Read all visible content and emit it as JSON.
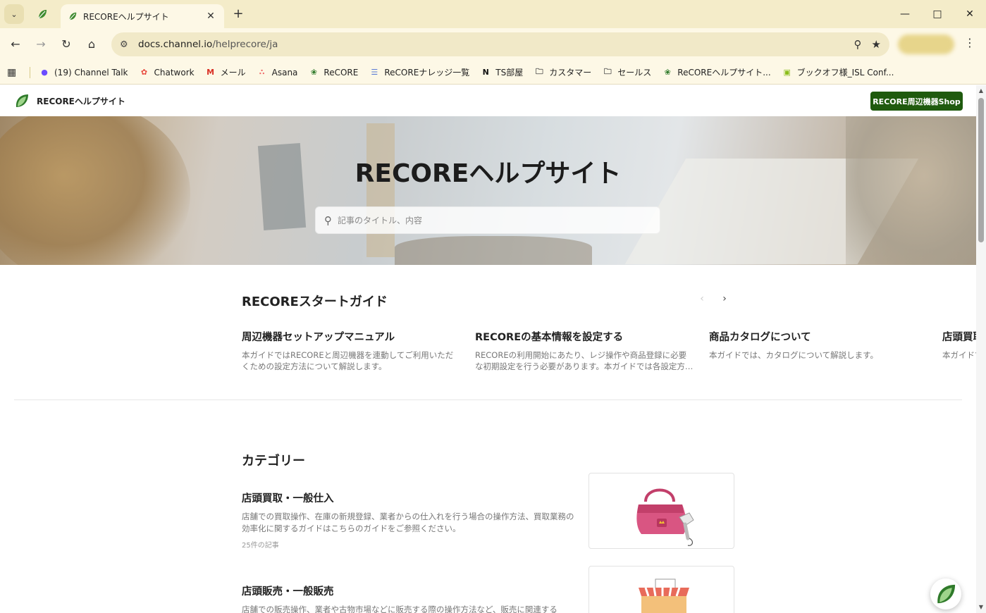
{
  "browser": {
    "tab_title": "RECOREヘルプサイト",
    "url_host": "docs.channel.io",
    "url_path": "/helprecore/ja",
    "bookmarks": [
      {
        "label": "(19) Channel Talk",
        "icon": "channel-talk-icon",
        "color": "#6b4cff"
      },
      {
        "label": "Chatwork",
        "icon": "chatwork-icon",
        "color": "#e8473c"
      },
      {
        "label": "メール",
        "icon": "gmail-icon",
        "color": "#d93025"
      },
      {
        "label": "Asana",
        "icon": "asana-icon",
        "color": "#f06a6a"
      },
      {
        "label": "ReCORE",
        "icon": "recore-leaf-icon",
        "color": "#2f7a2a"
      },
      {
        "label": "ReCOREナレッジ一覧",
        "icon": "knowledge-icon",
        "color": "#5b7bd5"
      },
      {
        "label": "TS部屋",
        "icon": "notion-icon",
        "color": "#111111"
      },
      {
        "label": "カスタマー",
        "icon": "folder-icon",
        "color": "#444444"
      },
      {
        "label": "セールス",
        "icon": "folder-icon",
        "color": "#444444"
      },
      {
        "label": "ReCOREヘルプサイト...",
        "icon": "recore-leaf-icon",
        "color": "#2f7a2a"
      },
      {
        "label": "ブックオフ様_ISL Conf...",
        "icon": "monitor-icon",
        "color": "#8bbd1a"
      }
    ]
  },
  "site": {
    "name": "RECOREヘルプサイト",
    "shop_button": "RECORE周辺機器Shop",
    "brand_color": "#1f5a0e"
  },
  "hero": {
    "title": "RECOREヘルプサイト",
    "search_placeholder": "記事のタイトル、内容"
  },
  "start_guide": {
    "title": "RECOREスタートガイド",
    "cards": [
      {
        "title": "周辺機器セットアップマニュアル",
        "desc": "本ガイドではRECOREと周辺機器を連動してご利用いただくための設定方法について解説します。"
      },
      {
        "title": "RECOREの基本情報を設定する",
        "desc": "RECOREの利用開始にあたり、レジ操作や商品登録に必要な初期設定を行う必要があります。本ガイドでは各設定方法について解説します。"
      },
      {
        "title": "商品カタログについて",
        "desc": "本ガイドでは、カタログについて解説します。"
      },
      {
        "title": "店頭買取",
        "desc": "本ガイドでは店頭買取の操作方法について解説します。"
      }
    ]
  },
  "categories": {
    "title": "カテゴリー",
    "items": [
      {
        "title": "店頭買取・一般仕入",
        "desc": "店舗での買取操作、在庫の新規登録、業者からの仕入れを行う場合の操作方法、買取業務の効率化に関するガイドはこちらのガイドをご参照ください。",
        "count": "25件の記事"
      },
      {
        "title": "店頭販売・一般販売",
        "desc": "店舗での販売操作、業者や古物市場などに販売する際の操作方法など、販売に関連する",
        "count": ""
      }
    ]
  }
}
